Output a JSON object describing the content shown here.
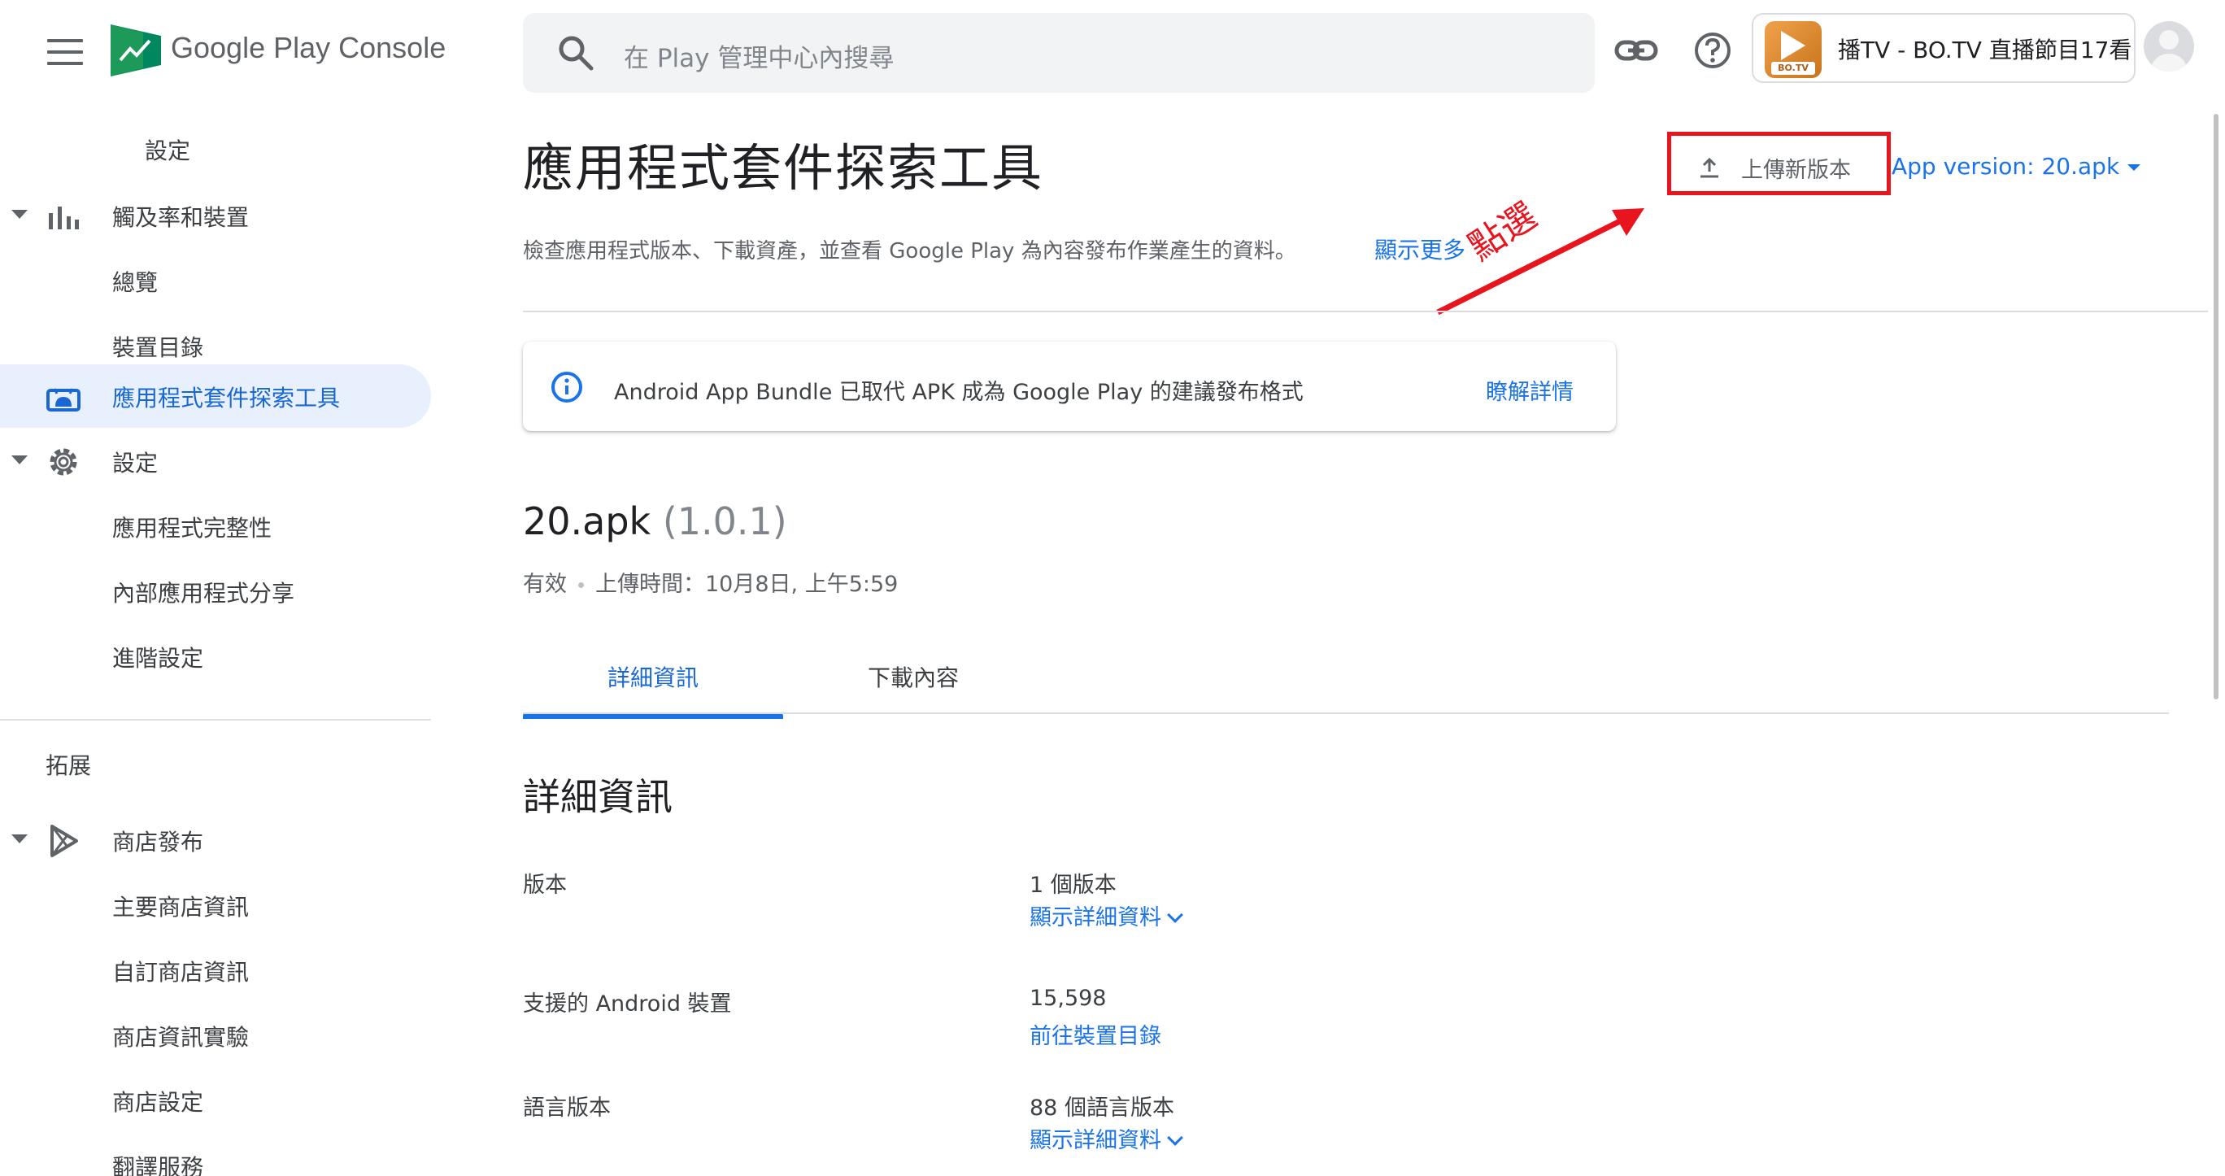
{
  "header": {
    "brand": "Google Play",
    "brand_suffix": " Console",
    "search_placeholder": "在 Play 管理中心內搜尋",
    "app_name": "播TV - BO.TV 直播節目17看",
    "app_icon_tag": "BO.TV"
  },
  "sidebar": {
    "items": [
      {
        "label": "設定"
      },
      {
        "label": "觸及率和裝置"
      },
      {
        "label": "總覽"
      },
      {
        "label": "裝置目錄"
      },
      {
        "label": "應用程式套件探索工具"
      },
      {
        "label": "設定"
      },
      {
        "label": "應用程式完整性"
      },
      {
        "label": "內部應用程式分享"
      },
      {
        "label": "進階設定"
      }
    ],
    "section_label": "拓展",
    "items2": [
      {
        "label": "商店發布"
      },
      {
        "label": "主要商店資訊"
      },
      {
        "label": "自訂商店資訊"
      },
      {
        "label": "商店資訊實驗"
      },
      {
        "label": "商店設定"
      },
      {
        "label": "翻譯服務"
      }
    ]
  },
  "main": {
    "title": "應用程式套件探索工具",
    "description": "檢查應用程式版本、下載資產，並查看 Google Play 為內容發布作業產生的資料。",
    "show_more": "顯示更多",
    "upload_label": "上傳新版本",
    "version_select": "App version: 20.apk",
    "annotation": "點選",
    "info_banner": {
      "text": "Android App Bundle 已取代 APK 成為 Google Play 的建議發布格式",
      "link": "瞭解詳情"
    },
    "apk": {
      "name": "20.apk",
      "version": "(1.0.1)",
      "status": "有效",
      "uploaded": "上傳時間：10月8日, 上午5:59"
    },
    "tabs": [
      {
        "label": "詳細資訊"
      },
      {
        "label": "下載內容"
      }
    ],
    "section_title": "詳細資訊",
    "details": [
      {
        "key": "版本",
        "value": "1 個版本",
        "link": "顯示詳細資料"
      },
      {
        "key": "支援的 Android 裝置",
        "value": "15,598",
        "link": "前往裝置目錄"
      },
      {
        "key": "語言版本",
        "value": "88 個語言版本",
        "link": "顯示詳細資料"
      }
    ]
  },
  "colors": {
    "accent": "#1a73e8",
    "active_nav_bg": "#e8f0fe",
    "annotation_red": "#e8141e"
  },
  "icons": [
    "menu-icon",
    "play-console-logo",
    "search-icon",
    "link-icon",
    "help-icon",
    "app-icon",
    "avatar-icon",
    "bar-chart-icon",
    "android-icon",
    "gear-icon",
    "play-triangle-icon",
    "upload-icon",
    "info-icon",
    "chevron-down-icon"
  ]
}
